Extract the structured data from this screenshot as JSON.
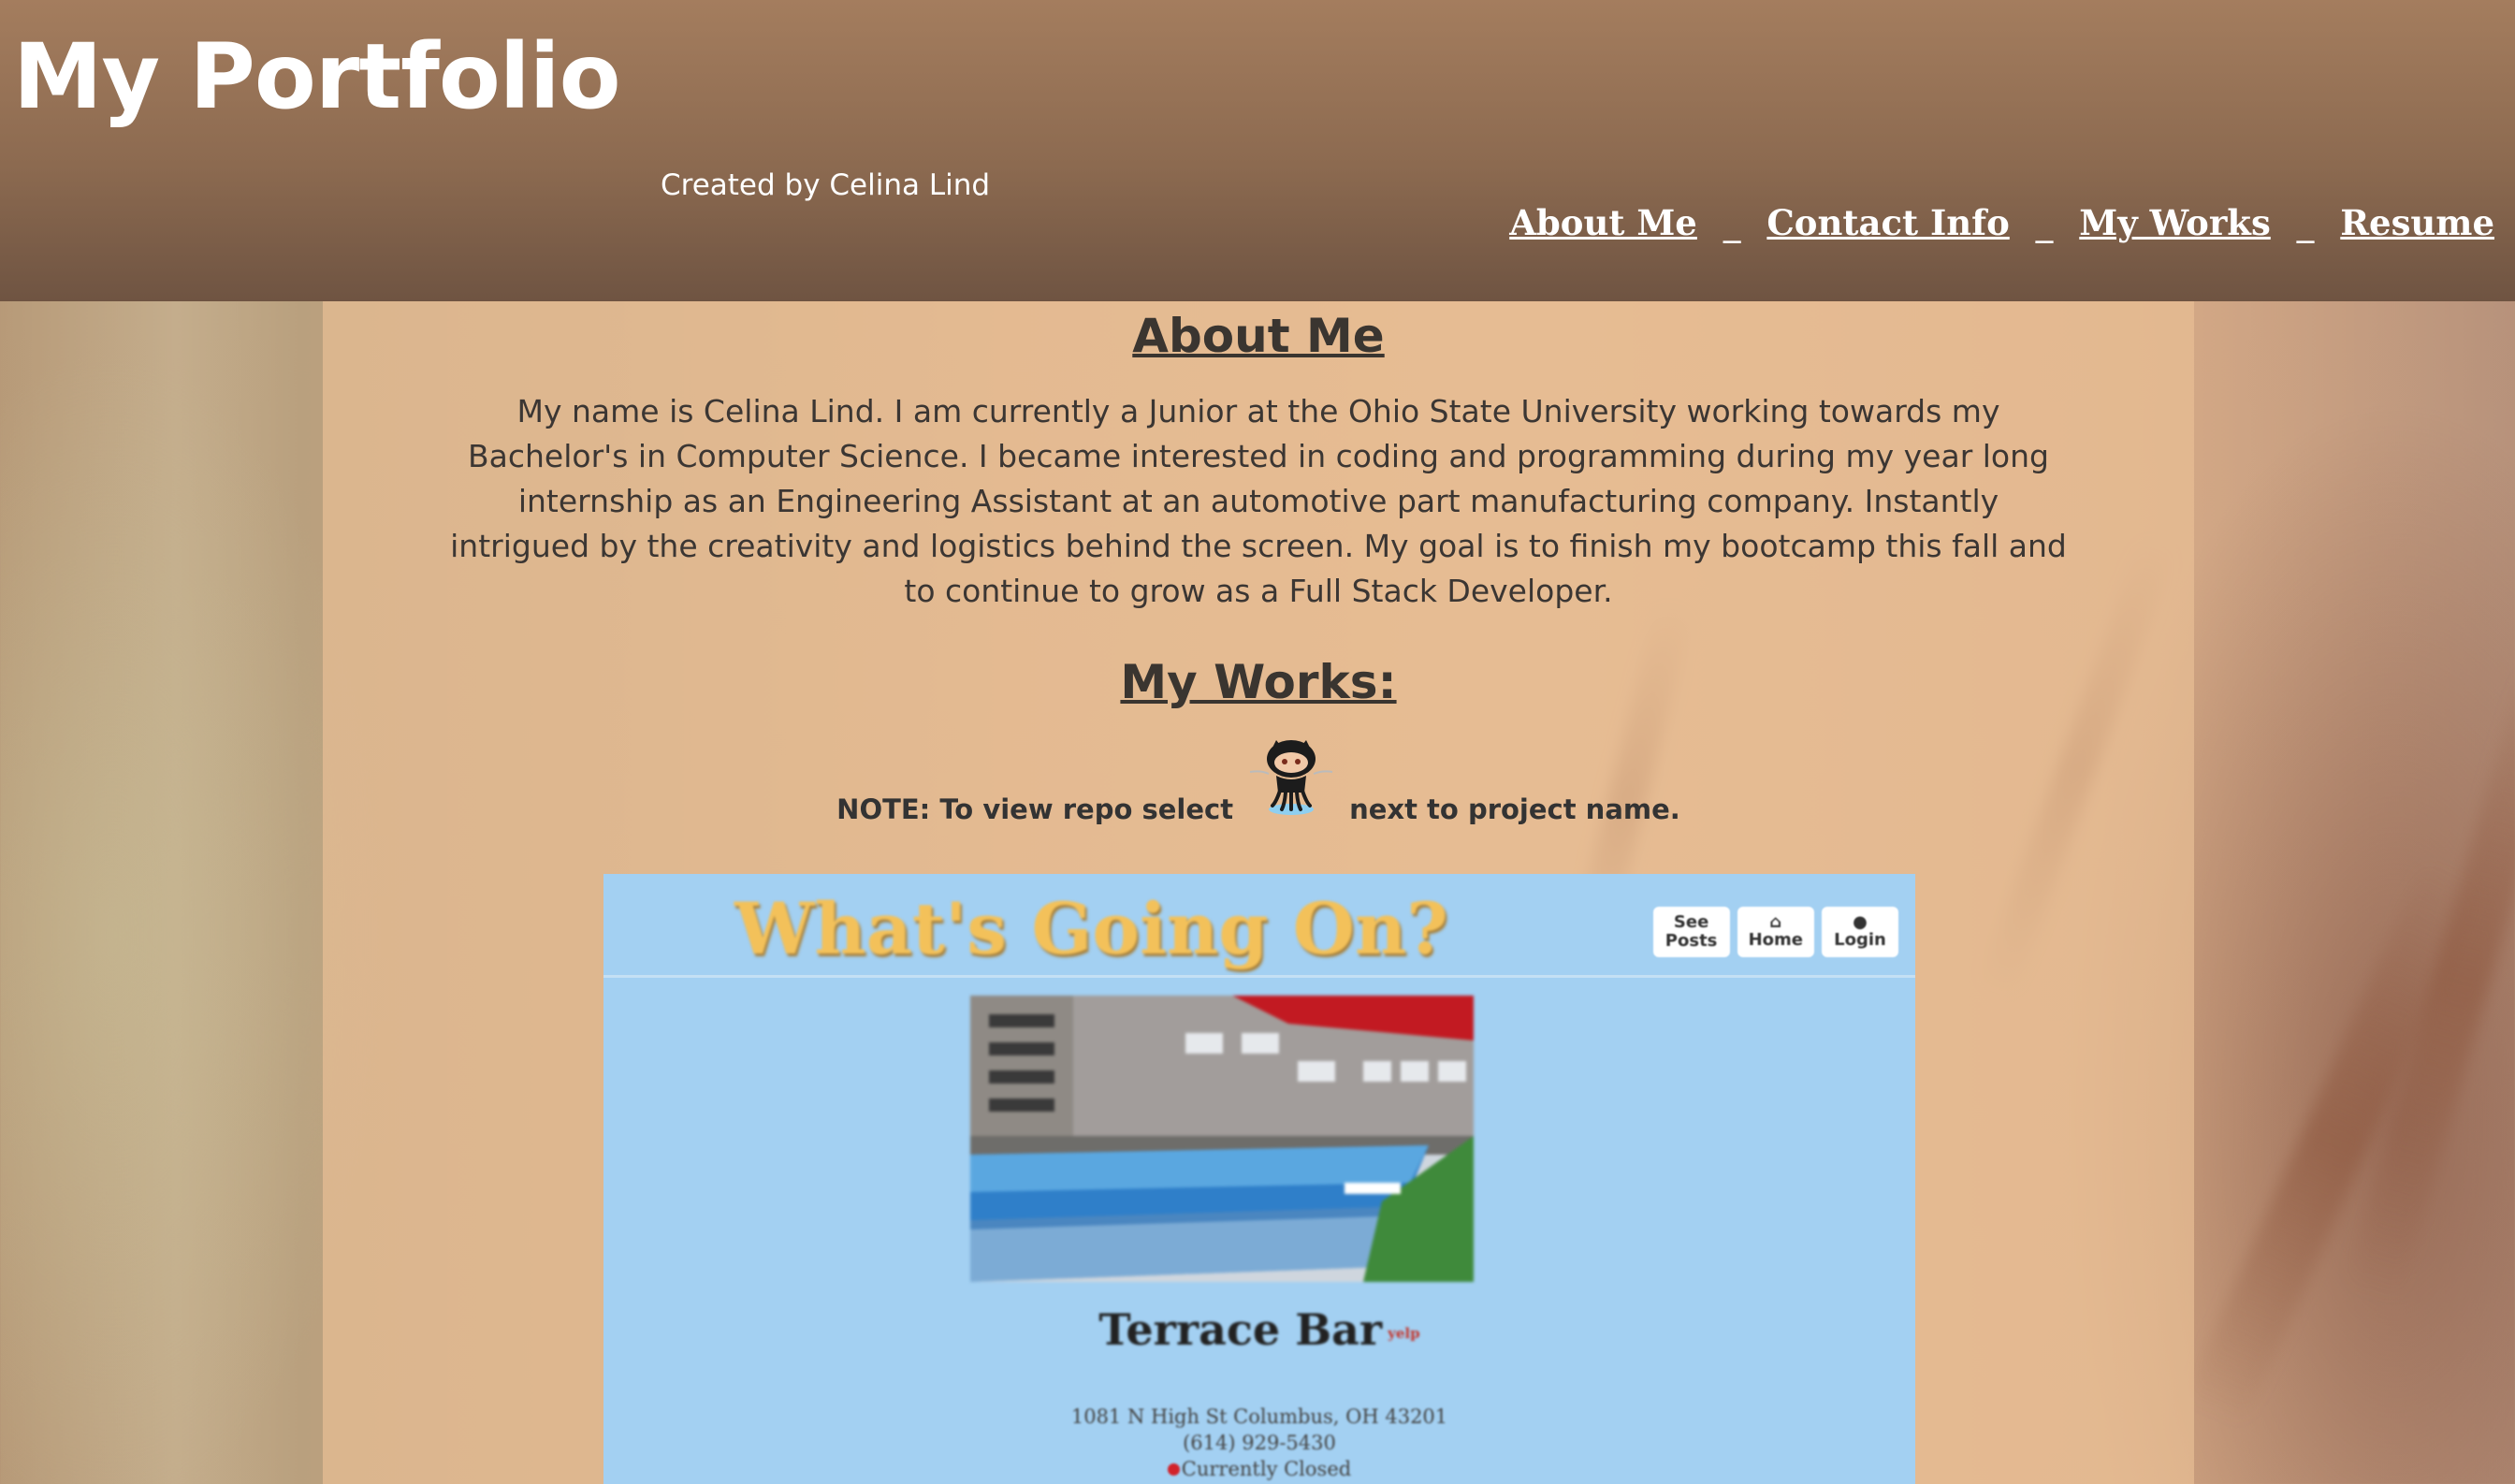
{
  "header": {
    "title": "My Portfolio",
    "byline": "Created by Celina Lind"
  },
  "nav": {
    "items": [
      {
        "label": "About Me"
      },
      {
        "label": "Contact Info"
      },
      {
        "label": "My Works"
      },
      {
        "label": "Resume"
      }
    ],
    "separator": "_"
  },
  "about": {
    "heading": "About Me",
    "text": "My name is Celina Lind. I am currently a Junior at the Ohio State University working towards my Bachelor's in Computer Science. I became interested in coding and programming during my year long internship as an Engineering Assistant at an automotive part manufacturing company. Instantly intrigued by the creativity and logistics behind the screen. My goal is to finish my bootcamp this fall and to continue to grow as a Full Stack Developer."
  },
  "works": {
    "heading": "My Works:",
    "note_before": "NOTE: To view repo select",
    "note_after": "next to project name.",
    "note_icon": "github-octocat-icon",
    "project": {
      "title": "What's Going On?",
      "buttons": [
        {
          "icon": "posts-icon",
          "label": "See Posts"
        },
        {
          "icon": "home-icon",
          "label": "Home"
        },
        {
          "icon": "user-icon",
          "label": "Login"
        }
      ],
      "venue_name": "Terrace Bar",
      "venue_badge": "yelp",
      "address": "1081 N High St Columbus, OH 43201",
      "phone": "(614) 929-5430",
      "status": "Currently Closed",
      "status_color": "#d2222a"
    }
  },
  "colors": {
    "header_bg": "#8c6a50",
    "project_bg": "#a3d0f2",
    "project_title": "#f3c15a"
  }
}
